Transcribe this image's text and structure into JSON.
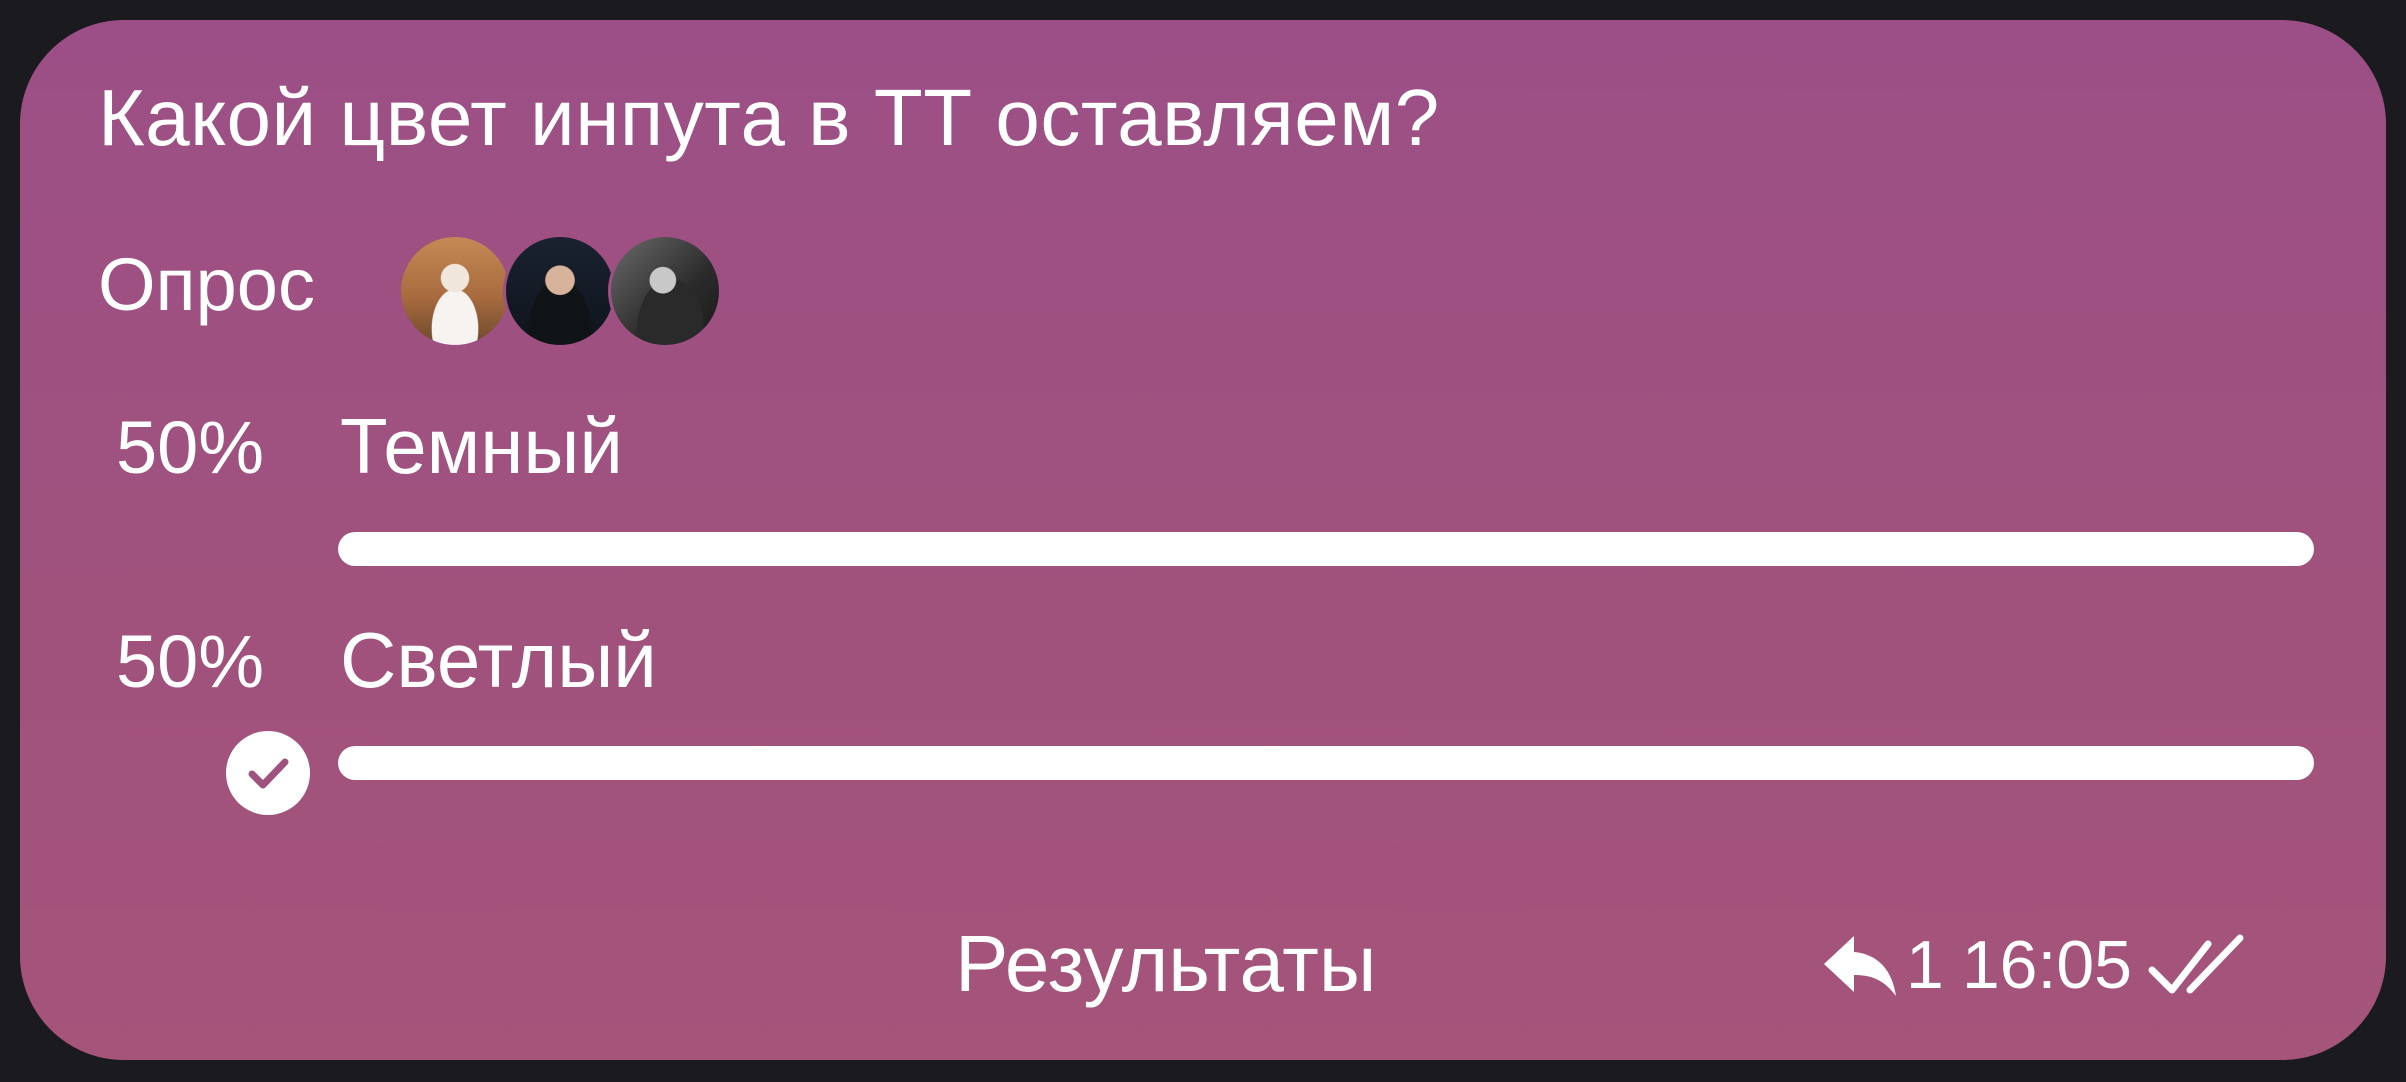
{
  "poll": {
    "question": "Какой цвет инпута в ТТ оставляем?",
    "type_label": "Опрос",
    "voters": [
      {
        "avatar": "avatar-voter-1"
      },
      {
        "avatar": "avatar-voter-2"
      },
      {
        "avatar": "avatar-voter-3"
      }
    ],
    "options": [
      {
        "percent": "50%",
        "label": "Темный",
        "fill_fraction": 1.0,
        "selected": false
      },
      {
        "percent": "50%",
        "label": "Светлый",
        "fill_fraction": 1.0,
        "selected": true
      }
    ],
    "results_label": "Результаты"
  },
  "message": {
    "reply_icon": "reply-icon",
    "reply_count": "1",
    "time": "16:05",
    "status_icon": "double-check-icon"
  },
  "colors": {
    "bubble": "#a0527f",
    "background": "#1b1a1f",
    "text": "#ffffff"
  }
}
